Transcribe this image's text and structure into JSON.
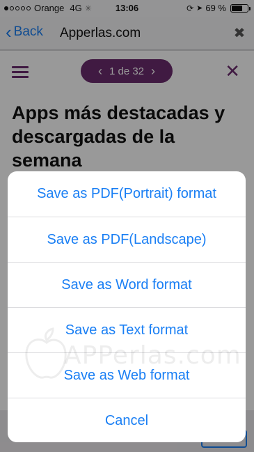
{
  "status_bar": {
    "carrier": "Orange",
    "network": "4G",
    "activity": "✳",
    "time": "13:06",
    "battery_text": "69 %",
    "battery_level": 0.69,
    "signal_filled": 1
  },
  "nav": {
    "back_label": "Back",
    "url": "Apperlas.com",
    "clear_glyph": "✖"
  },
  "page": {
    "pager_text": "1 de 32",
    "prev_glyph": "‹",
    "next_glyph": "›",
    "close_glyph": "✕",
    "title": "Apps más destacadas y descargadas de la semana"
  },
  "action_sheet": {
    "options": [
      "Save as PDF(Portrait) format",
      "Save as PDF(Landscape)",
      "Save as Word format",
      "Save as Text format",
      "Save as Web format",
      "Cancel"
    ]
  },
  "watermark": {
    "text": "APPerlas.com"
  },
  "colors": {
    "ios_blue": "#1a7ff4",
    "brand_purple": "#6c2c6e"
  }
}
